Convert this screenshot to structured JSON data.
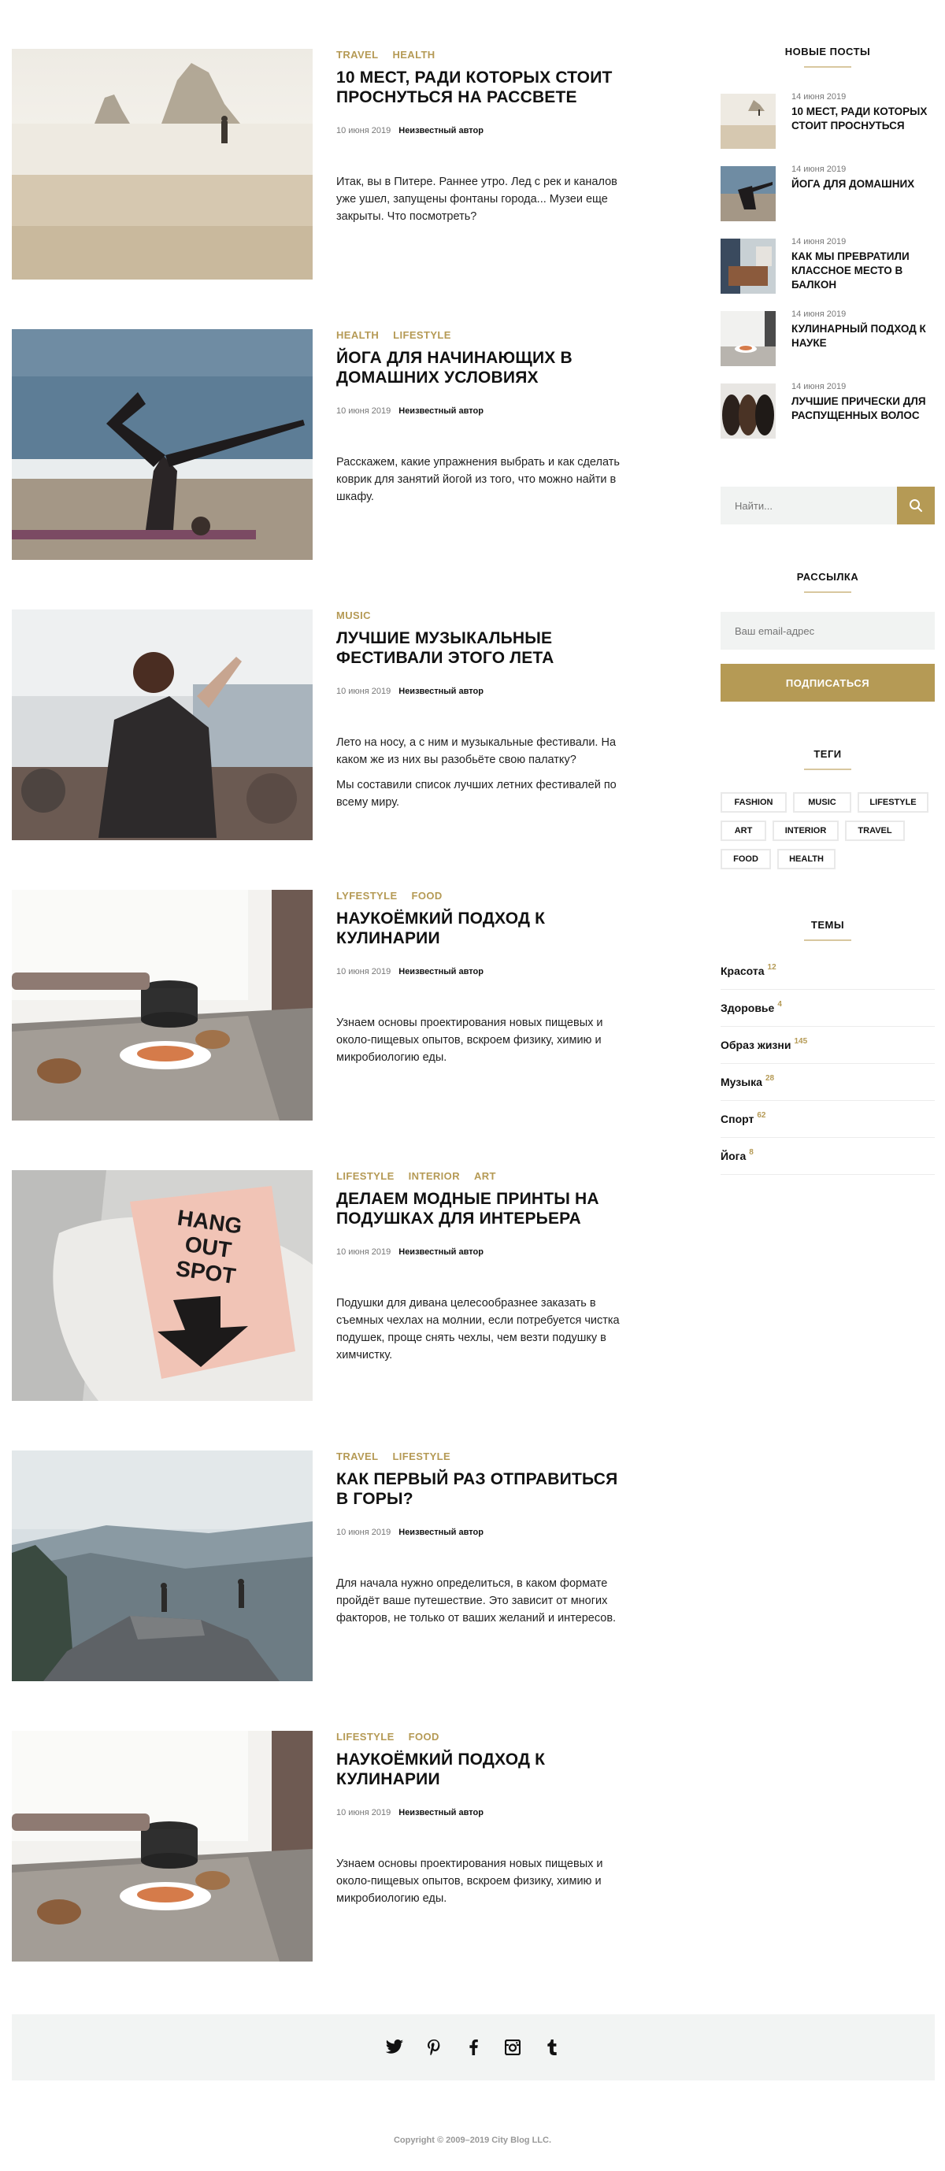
{
  "posts": [
    {
      "categories": [
        "TRAVEL",
        "HEALTH"
      ],
      "title": "10 мест, ради которых стоит проснуться на рассвете",
      "date": "10 июня 2019",
      "author": "Неизвестный автор",
      "excerpt": [
        "Итак, вы в Питере. Раннее утро. Лед с рек и каналов уже ушел, запущены фонтаны города... Музеи еще закрыты. Что посмотреть?"
      ]
    },
    {
      "categories": [
        "HEALTH",
        "LIFESTYLE"
      ],
      "title": "Йога для начинающих в домашних условиях",
      "date": "10 июня 2019",
      "author": "Неизвестный автор",
      "excerpt": [
        "Расскажем, какие упражнения выбрать и как сделать коврик для занятий йогой из того, что можно найти в шкафу."
      ]
    },
    {
      "categories": [
        "MUSIC"
      ],
      "title": "Лучшие музыкальные фестивали этого лета",
      "date": "10 июня 2019",
      "author": "Неизвестный автор",
      "excerpt": [
        "Лето на носу, а с ним и музыкальные фестивали. На каком же из них вы разобьёте свою палатку?",
        "Мы составили список лучших летних фестивалей по всему миру."
      ]
    },
    {
      "categories": [
        "LYFESTYLE",
        "FOOD"
      ],
      "title": "Наукоёмкий подход к кулинарии",
      "date": "10 июня 2019",
      "author": "Неизвестный автор",
      "excerpt": [
        "Узнаем основы проектирования новых пищевых и около-пищевых опытов, вскроем физику, химию и микробиологию еды."
      ]
    },
    {
      "categories": [
        "LIFESTYLE",
        "INTERIOR",
        "ART"
      ],
      "title": "Делаем модные принты на подушках для интерьера",
      "date": "10 июня 2019",
      "author": "Неизвестный автор",
      "excerpt": [
        "Подушки для дивана целесообразнее заказать в съемных чехлах на молнии, если потребуется чистка подушек, проще снять чехлы, чем везти подушку в химчистку."
      ],
      "image_text": [
        "HANG",
        "OUT",
        "SPOT"
      ]
    },
    {
      "categories": [
        "TRAVEL",
        "LIFESTYLE"
      ],
      "title": "Как первый раз отправиться в горы?",
      "date": "10 июня 2019",
      "author": "Неизвестный автор",
      "excerpt": [
        "Для начала нужно определиться, в каком формате пройдёт ваше путешествие. Это зависит от многих факторов, не только от ваших желаний и интересов."
      ]
    },
    {
      "categories": [
        "LIFESTYLE",
        "FOOD"
      ],
      "title": "Наукоёмкий подход к кулинарии",
      "date": "10 июня 2019",
      "author": "Неизвестный автор",
      "excerpt": [
        "Узнаем основы проектирования новых пищевых и около-пищевых опытов, вскроем физику, химию и микробиологию еды."
      ]
    }
  ],
  "sidebar": {
    "recent_title": "Новые посты",
    "recent": [
      {
        "date": "14 июня 2019",
        "title": "10 мест, ради которых стоит проснуться"
      },
      {
        "date": "14 июня 2019",
        "title": "Йога для домашних"
      },
      {
        "date": "14 июня 2019",
        "title": "Как мы превратили классное место в балкон"
      },
      {
        "date": "14 июня 2019",
        "title": "Кулинарный подход к науке"
      },
      {
        "date": "14 июня 2019",
        "title": "Лучшие прически для распущенных волос"
      }
    ],
    "search_placeholder": "Найти...",
    "newsletter_title": "Рассылка",
    "email_placeholder": "Ваш email-адрес",
    "subscribe_label": "Подписаться",
    "tags_title": "Теги",
    "tags": [
      "FASHION",
      "MUSIC",
      "LIFESTYLE",
      "ART",
      "INTERIOR",
      "TRAVEL",
      "FOOD",
      "HEALTH"
    ],
    "topics_title": "Темы",
    "topics": [
      {
        "name": "Красота",
        "count": "12"
      },
      {
        "name": "Здоровье",
        "count": "4"
      },
      {
        "name": "Образ жизни",
        "count": "145"
      },
      {
        "name": "Музыка",
        "count": "28"
      },
      {
        "name": "Спорт",
        "count": "62"
      },
      {
        "name": "Йога",
        "count": "8"
      }
    ]
  },
  "footer": {
    "social_icons": [
      "twitter-icon",
      "pinterest-icon",
      "facebook-icon",
      "instagram-icon",
      "tumblr-icon"
    ],
    "copyright": "Copyright © 2009–2019 City Blog LLC."
  },
  "colors": {
    "accent": "#b59a55",
    "light_bg": "#f1f3f2",
    "text": "#111111"
  }
}
